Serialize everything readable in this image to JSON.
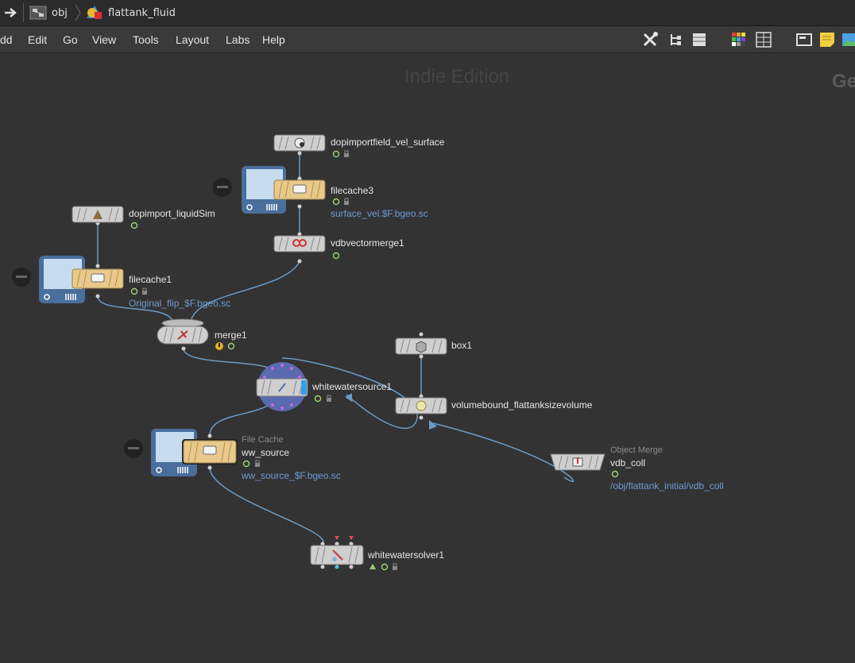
{
  "pathbar": {
    "crumbs": [
      {
        "label": "obj"
      },
      {
        "label": "flattank_fluid"
      }
    ]
  },
  "menu": [
    "dd",
    "Edit",
    "Go",
    "View",
    "Tools",
    "Layout",
    "Labs",
    "Help"
  ],
  "toolbar_icons": [
    "tools-icon",
    "tree-view-icon",
    "list-view-icon",
    "color-palette-icon",
    "grid-view-icon",
    "network-box-icon",
    "sticky-note-icon",
    "image-icon"
  ],
  "canvas": {
    "watermark": "Indie Edition",
    "watermark_right": "Ge"
  },
  "nodes": {
    "dopimportfield": {
      "name": "dopimportfield_vel_surface"
    },
    "filecache3": {
      "name": "filecache3",
      "path": "surface_vel.$F.bgeo.sc"
    },
    "dopimport_liquid": {
      "name": "dopimport_liquidSim"
    },
    "vdbvectormerge": {
      "name": "vdbvectormerge1"
    },
    "filecache1": {
      "name": "filecache1",
      "path": "Original_flip_$F.bgeo.sc"
    },
    "merge1": {
      "name": "merge1"
    },
    "box1": {
      "name": "box1"
    },
    "whitewatersource": {
      "name": "whitewatersource1"
    },
    "volumebound": {
      "name": "volumebound_flattanksizevolume"
    },
    "ww_source": {
      "type": "File Cache",
      "name": "ww_source",
      "path": "ww_source_$F.bgeo.sc"
    },
    "vdb_coll": {
      "type": "Object Merge",
      "name": "vdb_coll",
      "path": "/obj/flattank_initial/vdb_coll"
    },
    "whitewatersolver": {
      "name": "whitewatersolver1"
    }
  },
  "colors": {
    "background": "#333333",
    "wire": "#6a9cc8",
    "filecache_node": "#e8c98a",
    "disk_body": "#4a6f9c",
    "flag_green": "#9bd27a",
    "warning": "#e0b020"
  }
}
